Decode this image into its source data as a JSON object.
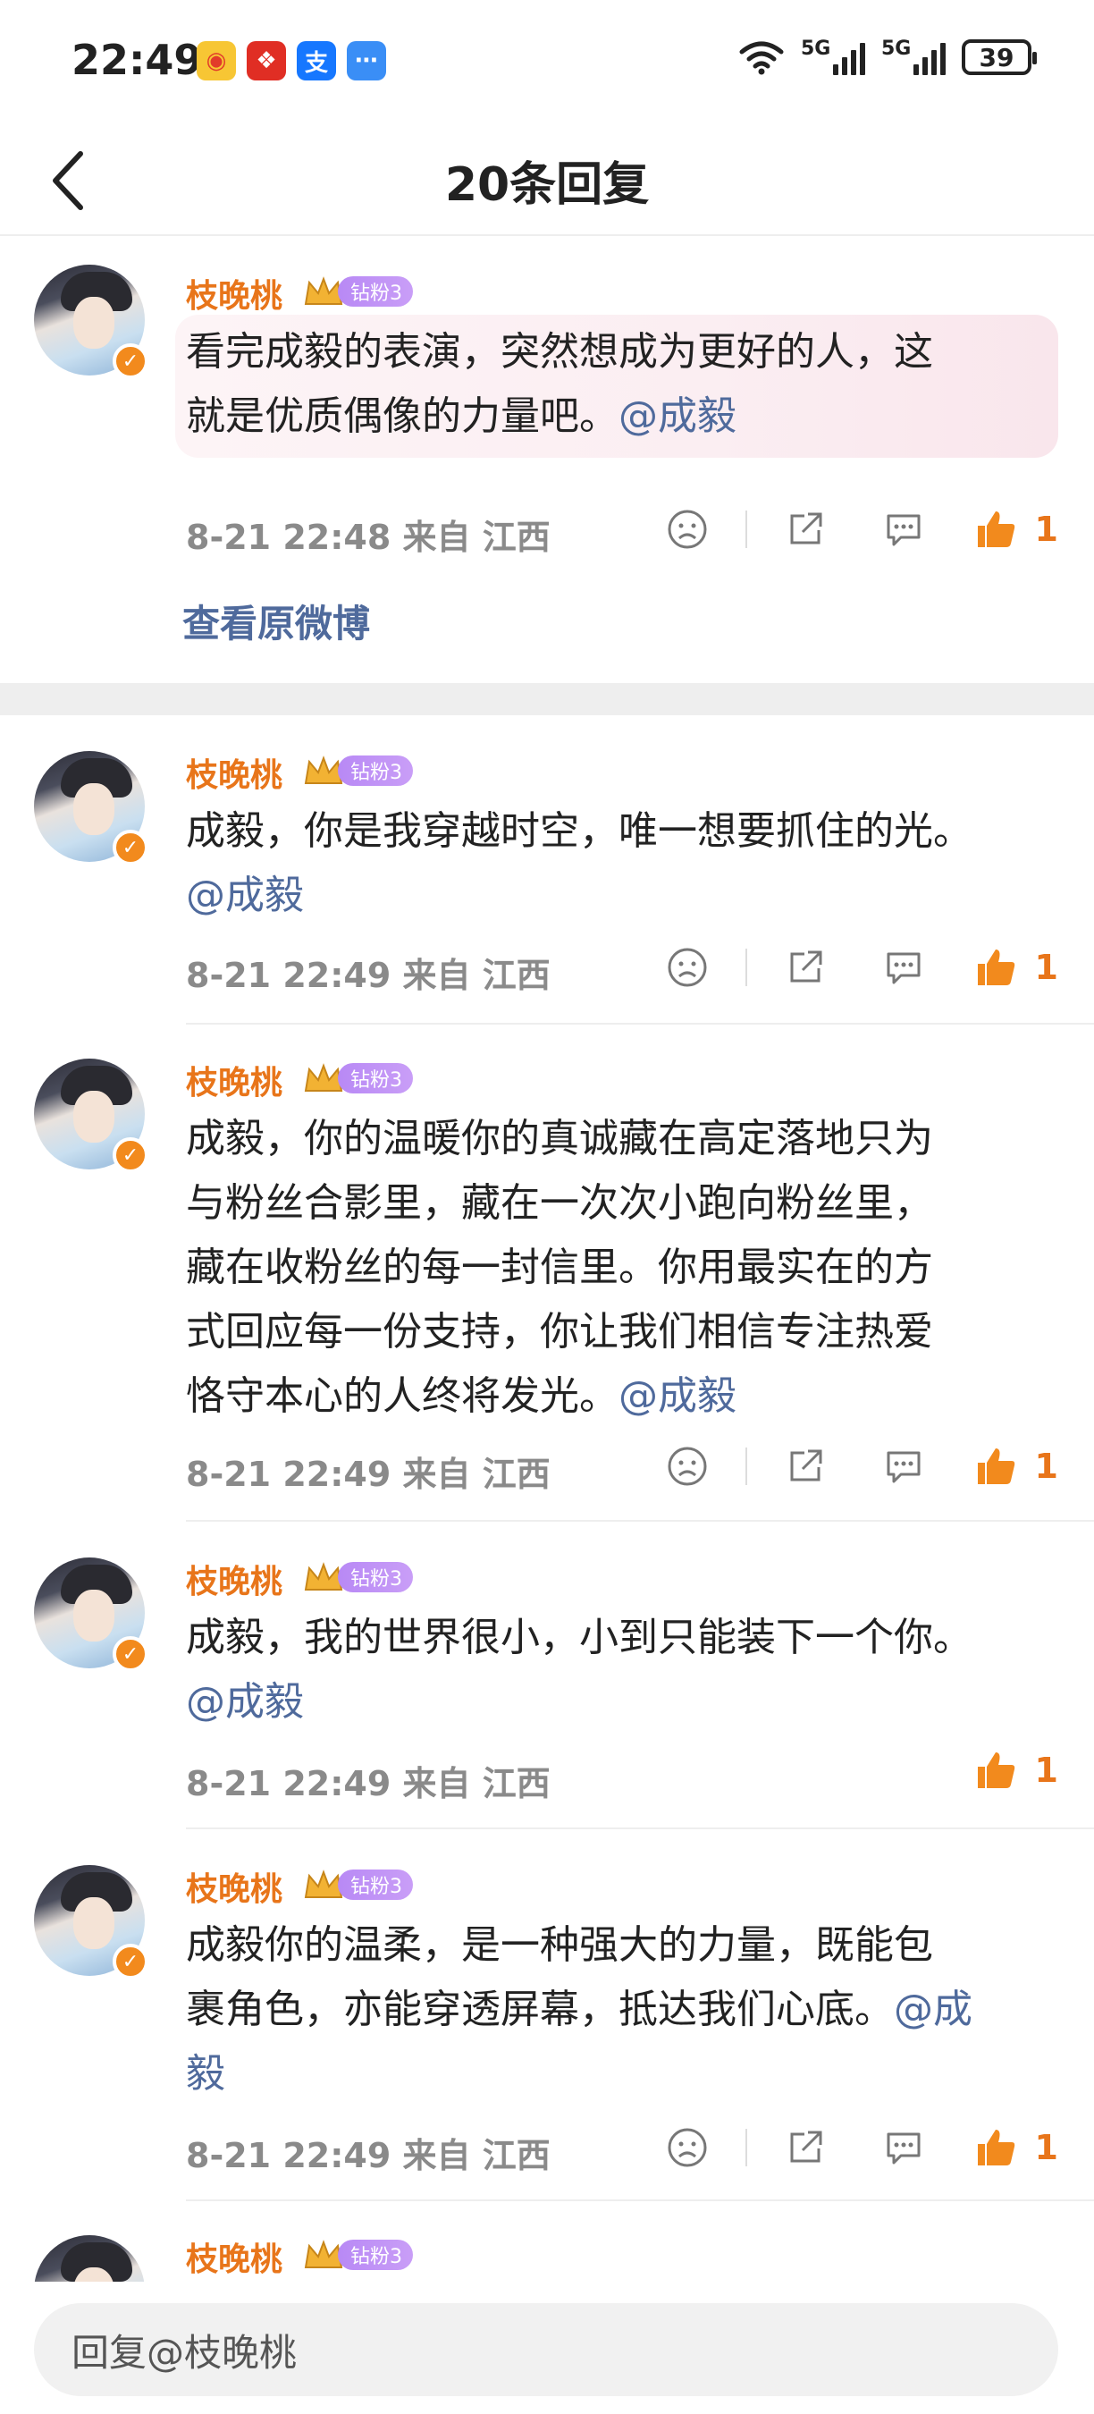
{
  "status_bar": {
    "time": "22:49",
    "apps": [
      "weibo-icon",
      "pinduoduo-icon",
      "alipay-icon",
      "message-icon"
    ],
    "network1": "5G",
    "network2": "5G",
    "battery": "39"
  },
  "header": {
    "title": "20条回复"
  },
  "main_comment": {
    "username": "枝晚桃",
    "fan_badge": "钻粉3",
    "text_lines": [
      "看完成毅的表演，突然想成为更好的人，这",
      "就是优质偶像的力量吧。"
    ],
    "mention": "@成毅",
    "meta": "8-21 22:48 来自 江西",
    "like_count": "1",
    "view_original": "查看原微博"
  },
  "replies": [
    {
      "username": "枝晚桃",
      "fan_badge": "钻粉3",
      "text_lines": [
        "成毅，你是我穿越时空，唯一想要抓住的光。"
      ],
      "mention": "@成毅",
      "meta": "8-21 22:49 来自 江西",
      "like_count": "1"
    },
    {
      "username": "枝晚桃",
      "fan_badge": "钻粉3",
      "text_lines": [
        "成毅，你的温暖你的真诚藏在高定落地只为",
        "与粉丝合影里，藏在一次次小跑向粉丝里，",
        "藏在收粉丝的每一封信里。你用最实在的方",
        "式回应每一份支持，你让我们相信专注热爱",
        "恪守本心的人终将发光。"
      ],
      "mention": "@成毅",
      "meta": "8-21 22:49 来自 江西",
      "like_count": "1"
    },
    {
      "username": "枝晚桃",
      "fan_badge": "钻粉3",
      "text_lines": [
        "成毅，我的世界很小，小到只能装下一个你。"
      ],
      "mention": "@成毅",
      "meta": "8-21 22:49 来自 江西",
      "like_count": "1"
    },
    {
      "username": "枝晚桃",
      "fan_badge": "钻粉3",
      "text_lines": [
        "成毅你的温柔，是一种强大的力量，既能包",
        "裹角色，亦能穿透屏幕，抵达我们心底。"
      ],
      "mention_part1": "@成",
      "mention_part2": "毅",
      "meta": "8-21 22:49 来自 江西",
      "like_count": "1"
    },
    {
      "username": "枝晚桃",
      "fan_badge": "钻粉3"
    }
  ],
  "bottom_bar": {
    "reply_placeholder": "回复@枝晚桃"
  },
  "colors": {
    "accent_orange": "#e8751a",
    "mention_blue": "#4f6a9c",
    "meta_gray": "#8a8a8a"
  }
}
